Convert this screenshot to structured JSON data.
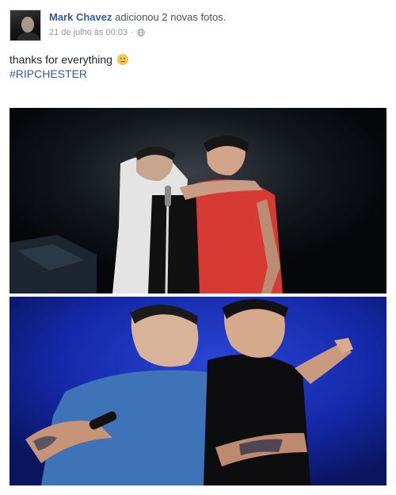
{
  "post": {
    "author": "Mark Chavez",
    "action": "adicionou 2 novas fotos.",
    "timestamp": "21 de julho às 00:03",
    "separator": "·",
    "privacy_icon": "globe-icon",
    "message": "thanks for everything",
    "emoji": "crying-face-emoji",
    "hashtag": "#RIPCHESTER"
  },
  "photos": [
    {
      "subject": "two men embracing on a dark stage"
    },
    {
      "subject": "two men hugging and laughing under blue stage lights"
    }
  ],
  "colors": {
    "author": "#365899",
    "text": "#1d2129",
    "meta": "#90949c",
    "hashtag": "#365899",
    "photo2_bg": "#0e1f8a"
  }
}
